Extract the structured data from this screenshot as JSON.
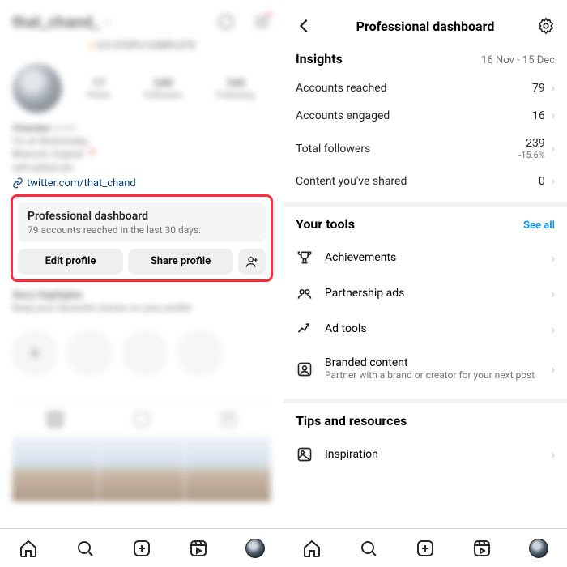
{
  "left": {
    "username": "that_chand_",
    "steps": "3/5 STEPS COMPLETE",
    "stats": {
      "posts_n": "17",
      "posts_l": "Posts",
      "followers_n": "240",
      "followers_l": "Followers",
      "following_n": "160",
      "following_l": "Following"
    },
    "bio": {
      "name": "Chandan",
      "cat": "Artist",
      "l1": "I'm at Wednesday",
      "l2": "Bharuch, Gujarat 📍",
      "l3": "self-edited etc."
    },
    "link": "twitter.com/that_chand",
    "dash": {
      "title": "Professional dashboard",
      "sub": "79 accounts reached in the last 30 days."
    },
    "buttons": {
      "edit": "Edit profile",
      "share": "Share profile"
    },
    "highlights": {
      "title": "Story Highlights",
      "sub": "Keep your favourite stories on your profile",
      "new": "New"
    }
  },
  "right": {
    "header": "Professional dashboard",
    "insights": {
      "title": "Insights",
      "range": "16 Nov - 15 Dec",
      "rows": {
        "reached": {
          "label": "Accounts reached",
          "value": "79"
        },
        "engaged": {
          "label": "Accounts engaged",
          "value": "16"
        },
        "followers": {
          "label": "Total followers",
          "value": "239",
          "delta": "-15.6%"
        },
        "content": {
          "label": "Content you've shared",
          "value": "0"
        }
      }
    },
    "tools": {
      "title": "Your tools",
      "seeall": "See all",
      "achievements": "Achievements",
      "partnership": "Partnership ads",
      "adtools": "Ad tools",
      "branded": "Branded content",
      "branded_sub": "Partner with a brand or creator for your next post"
    },
    "tips": {
      "title": "Tips and resources",
      "inspiration": "Inspiration"
    }
  }
}
